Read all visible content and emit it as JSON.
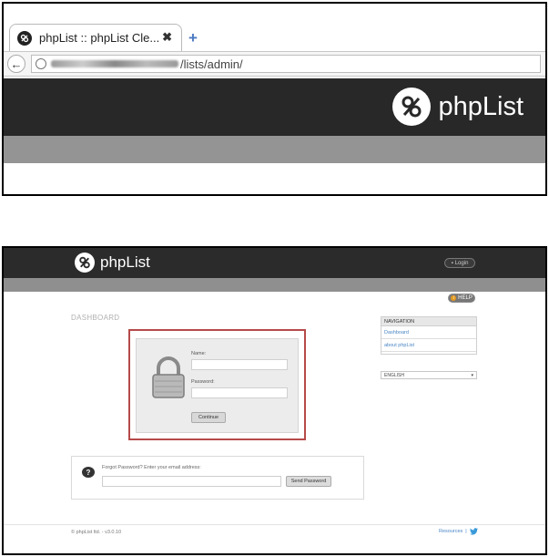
{
  "browser": {
    "tab_title": "phpList :: phpList Cle...",
    "close_glyph": "✖",
    "new_tab_glyph": "+",
    "back_glyph": "←",
    "url_suffix": "/lists/admin/"
  },
  "hero": {
    "brand": "phpList"
  },
  "admin": {
    "brand": "phpList",
    "login_label": "Login",
    "help_label": "HELP",
    "page_title": "DASHBOARD",
    "login_form": {
      "name_label": "Name:",
      "password_label": "Password:",
      "continue_label": "Continue"
    },
    "forgot": {
      "prompt": "Forgot Password? Enter your email address:",
      "send_label": "Send Password"
    },
    "navigation": {
      "heading": "NAVIGATION",
      "items": [
        {
          "label": "Dashboard"
        },
        {
          "label": "about phpList"
        }
      ]
    },
    "language": {
      "selected": "ENGLISH"
    },
    "footer": {
      "left": "© phpList ltd. - v3.0.10",
      "resources": "Resources",
      "separator": "|"
    }
  },
  "colors": {
    "header_dark": "#282828",
    "band_grey": "#949494",
    "highlight_border": "#b64a4a",
    "link_blue": "#4a86c5",
    "help_orange": "#e59a1e"
  }
}
